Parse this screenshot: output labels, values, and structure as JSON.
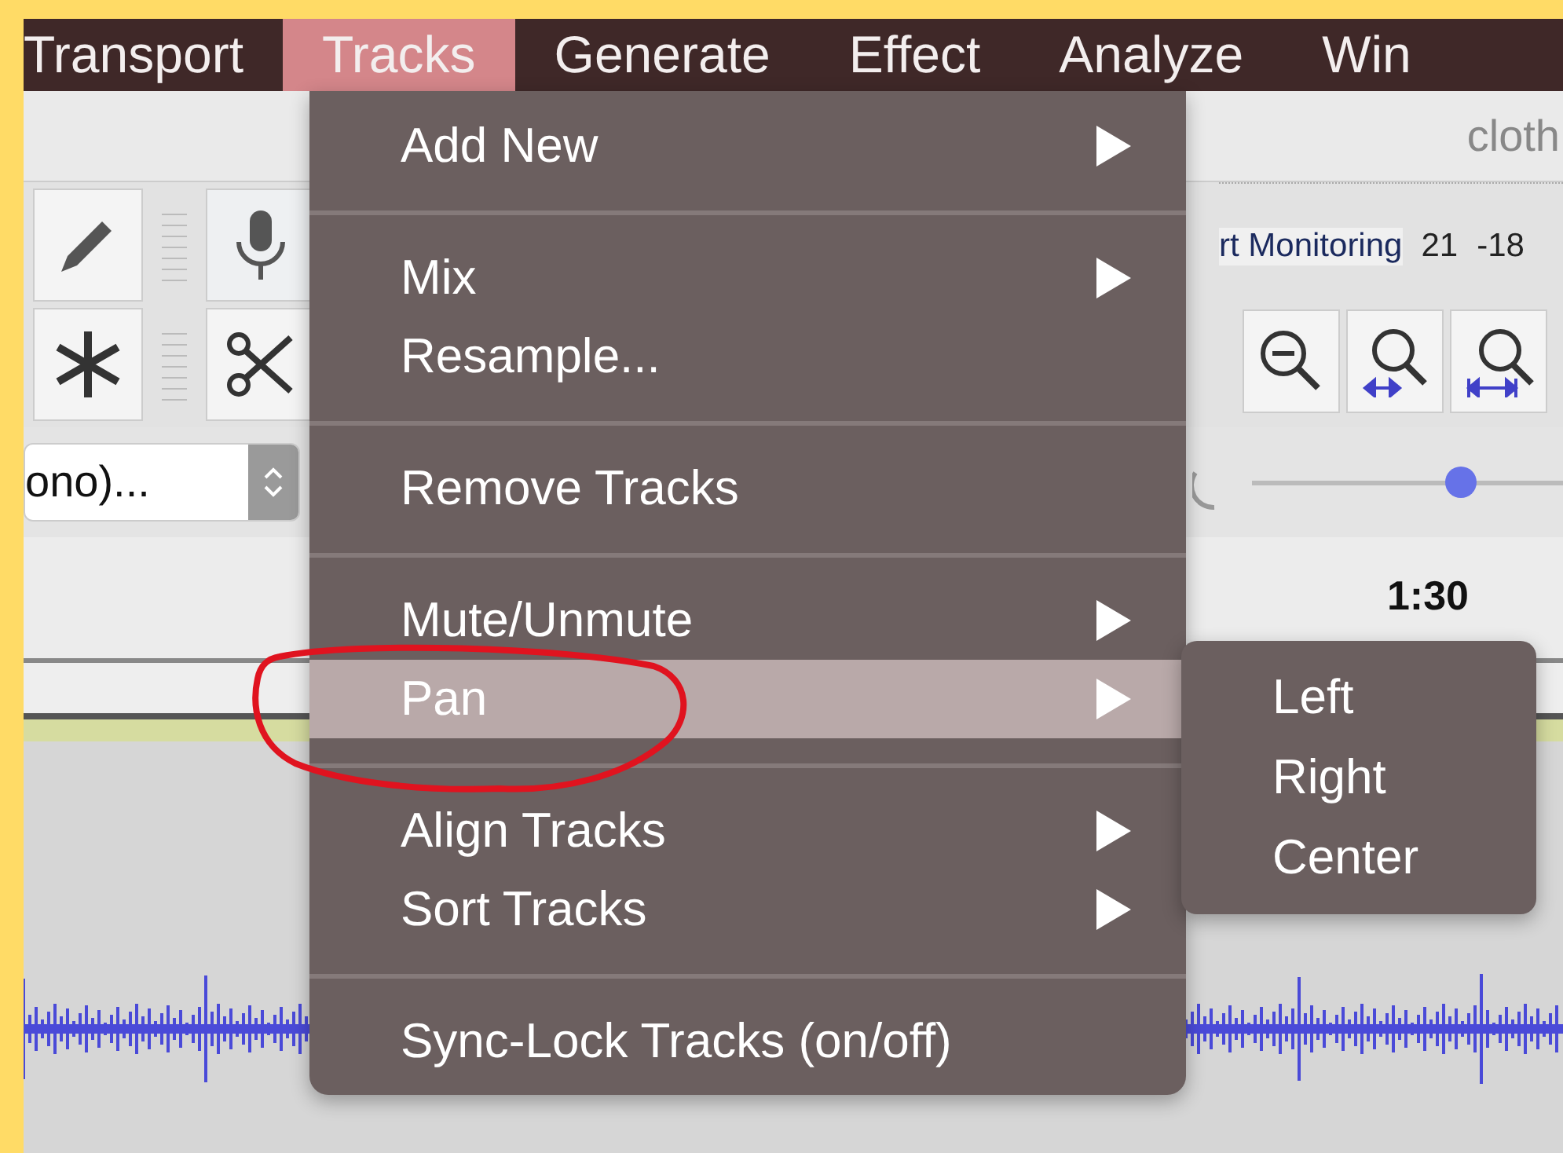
{
  "menu_bar": [
    {
      "label": "Transport",
      "selected": false
    },
    {
      "label": "Tracks",
      "selected": true
    },
    {
      "label": "Generate",
      "selected": false
    },
    {
      "label": "Effect",
      "selected": false
    },
    {
      "label": "Analyze",
      "selected": false
    },
    {
      "label": "Win",
      "selected": false
    }
  ],
  "window": {
    "title": "cloth"
  },
  "toolbar": {
    "monitoring_label": "rt Monitoring",
    "meter_ticks": [
      "21",
      "-18"
    ],
    "device_select": "ono)...",
    "slider": {
      "level": 0.67
    }
  },
  "timeline": {
    "time_label": "1:30"
  },
  "menu": {
    "items": [
      {
        "kind": "item",
        "label": "Add New",
        "submenu": true,
        "selected": false
      },
      {
        "kind": "separator"
      },
      {
        "kind": "item",
        "label": "Mix",
        "submenu": true,
        "selected": false
      },
      {
        "kind": "item",
        "label": "Resample...",
        "submenu": false,
        "selected": false
      },
      {
        "kind": "separator"
      },
      {
        "kind": "item",
        "label": "Remove Tracks",
        "submenu": false,
        "selected": false
      },
      {
        "kind": "separator"
      },
      {
        "kind": "item",
        "label": "Mute/Unmute",
        "submenu": true,
        "selected": false
      },
      {
        "kind": "item",
        "label": "Pan",
        "submenu": true,
        "selected": true
      },
      {
        "kind": "separator"
      },
      {
        "kind": "item",
        "label": "Align Tracks",
        "submenu": true,
        "selected": false
      },
      {
        "kind": "item",
        "label": "Sort Tracks",
        "submenu": true,
        "selected": false
      },
      {
        "kind": "separator"
      },
      {
        "kind": "item",
        "label": "Sync-Lock Tracks (on/off)",
        "submenu": false,
        "selected": false
      }
    ]
  },
  "submenu": {
    "items": [
      {
        "label": "Left"
      },
      {
        "label": "Right"
      },
      {
        "label": "Center"
      }
    ]
  },
  "annotation": {
    "kind": "circle"
  }
}
